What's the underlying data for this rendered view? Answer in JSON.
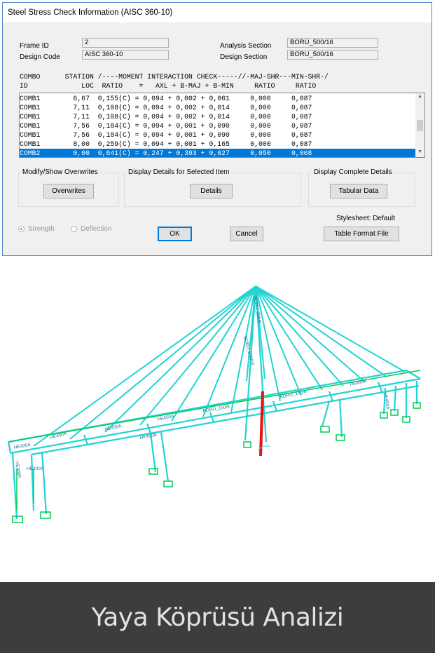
{
  "dialog": {
    "title": "Steel Stress Check Information (AISC 360-10)",
    "frame_id_label": "Frame ID",
    "frame_id_value": "2",
    "design_code_label": "Design Code",
    "design_code_value": "AISC 360-10",
    "analysis_section_label": "Analysis Section",
    "analysis_section_value": "BORU_500/16",
    "design_section_label": "Design Section",
    "design_section_value": "BORU_500/16",
    "header_line1": "COMBO      STATION /----MOMENT INTERACTION CHECK-----//-MAJ-SHR---MIN-SHR-/",
    "header_line2": "ID             LOC  RATIO    =   AXL + B-MAJ + B-MIN     RATIO     RATIO",
    "rows": [
      "COMB1        6,67  0,155(C) = 0,094 + 0,002 + 0,061     0,000     0,087",
      "COMB1        7,11  0,108(C) = 0,094 + 0,002 + 0,014     0,000     0,087",
      "COMB1        7,11  0,108(C) = 0,094 + 0,002 + 0,014     0,000     0,087",
      "COMB1        7,56  0,184(C) = 0,094 + 0,001 + 0,090     0,000     0,087",
      "COMB1        7,56  0,184(C) = 0,094 + 0,001 + 0,090     0,000     0,087",
      "COMB1        8,00  0,259(C) = 0,094 + 0,001 + 0,165     0,000     0,087",
      "COMB2        0,00  0,641(C) = 0,247 + 0,393 + 0,027     0,050     0,008"
    ],
    "selected_row": 6,
    "group_overwrites_title": "Modify/Show Overwrites",
    "overwrites_button": "Overwrites",
    "group_details_title": "Display Details for Selected Item",
    "details_button": "Details",
    "group_complete_title": "Display Complete Details",
    "tabular_button": "Tabular Data",
    "stylesheet_label": "Stylesheet: Default",
    "table_format_button": "Table Format File",
    "radio_strength": "Strength",
    "radio_deflection": "Deflection",
    "ok_button": "OK",
    "cancel_button": "Cancel",
    "selection_color": "#0078d7"
  },
  "model": {
    "frame_color": "#22d3d3",
    "member_color": "#00cc55",
    "highlight_color": "#e81010",
    "labels": {
      "pylon_top": "BORU_300/8",
      "pylon_mid": "BORU_500/16",
      "deck_left_1": "HE450A",
      "deck_left_2": "HE300A",
      "deck_left_3": "HE450A",
      "deck_mid_1": "HE450A",
      "deck_mid_2": "BORU_150/8",
      "deck_mid_3": "HE450B",
      "deck_right_1": "HE450A",
      "deck_right_2": "BORU_150/8",
      "column_left_1": "HE300A",
      "column_left_2": "HE300A",
      "column_right": "HE450A"
    }
  },
  "banner": {
    "caption": "Yaya Köprüsü Analizi",
    "background": "#3d3d3d"
  }
}
